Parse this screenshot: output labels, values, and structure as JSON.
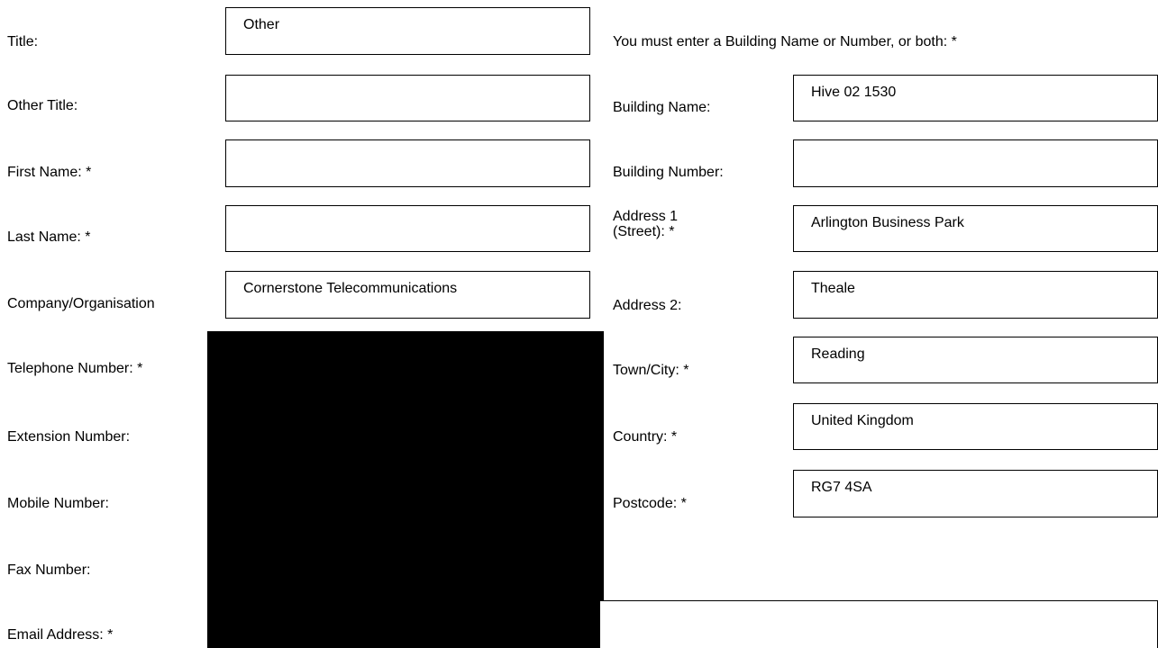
{
  "form": {
    "personal": {
      "title_label": "Title:",
      "title_value": "Other",
      "other_title_label": "Other Title:",
      "other_title_value": "",
      "first_name_label": "First Name: *",
      "first_name_value": "",
      "last_name_label": "Last Name: *",
      "last_name_value": "",
      "company_label": "Company/Organisation",
      "company_value": "Cornerstone Telecommunications",
      "telephone_label": "Telephone Number: *",
      "extension_label": "Extension Number:",
      "mobile_label": "Mobile Number:",
      "fax_label": "Fax Number:",
      "email_label": "Email Address: *"
    },
    "address": {
      "notice": "You must enter a Building Name or Number, or both: *",
      "building_name_label": "Building Name:",
      "building_name_value": "Hive 02 1530",
      "building_number_label": "Building Number:",
      "building_number_value": "",
      "address1_label_line1": "Address 1",
      "address1_label_line2": "(Street): *",
      "address1_value": "Arlington Business Park",
      "address2_label": "Address 2:",
      "address2_value": "Theale",
      "town_label": "Town/City: *",
      "town_value": "Reading",
      "country_label": "Country: *",
      "country_value": "United Kingdom",
      "postcode_label": "Postcode: *",
      "postcode_value": "RG7 4SA"
    }
  },
  "colors": {
    "border": "#000000",
    "background": "#ffffff",
    "redaction": "#000000"
  }
}
